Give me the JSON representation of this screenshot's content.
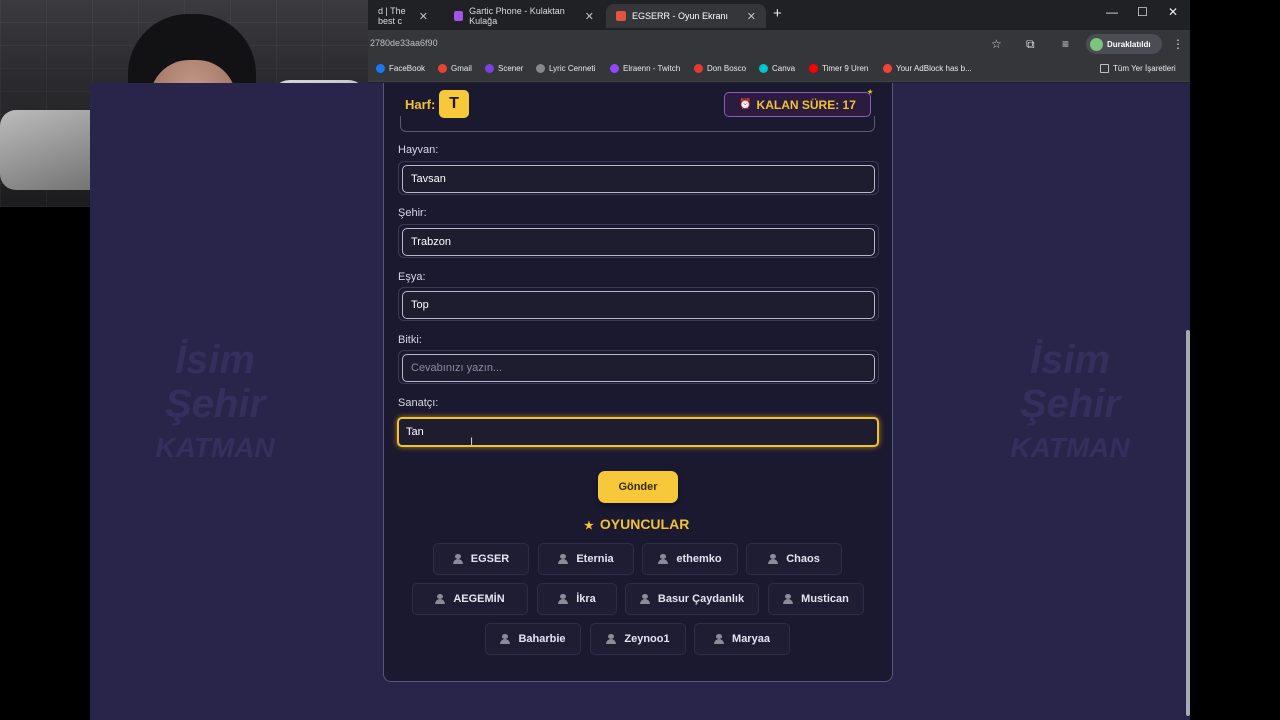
{
  "browser": {
    "tabs": [
      {
        "title": "d | The best c"
      },
      {
        "title": "Gartic Phone - Kulaktan Kulağa"
      },
      {
        "title": "EGSERR - Oyun Ekranı"
      }
    ],
    "url": "2780de33aa6f90",
    "profile_label": "Duraklatıldı",
    "bookmarks": [
      {
        "label": "FaceBook",
        "color": "#1877f2"
      },
      {
        "label": "Gmail",
        "color": "#ea4335"
      },
      {
        "label": "Scener",
        "color": "#7b3fe4"
      },
      {
        "label": "Lyric Cenneti",
        "color": "#888888"
      },
      {
        "label": "Elraenn - Twitch",
        "color": "#9146ff"
      },
      {
        "label": "Don Bosco",
        "color": "#e53935"
      },
      {
        "label": "Canva",
        "color": "#00c4cc"
      },
      {
        "label": "Timer 9 Uren",
        "color": "#ff0000"
      },
      {
        "label": "Your AdBlock has b...",
        "color": "#f44336"
      }
    ],
    "all_bookmarks": "Tüm Yer İşaretleri"
  },
  "game": {
    "letter_label": "Harf:",
    "letter": "T",
    "timer_label": "KALAN SÜRE: 17",
    "fields": [
      {
        "label": "Hayvan:",
        "value": "Tavsan",
        "placeholder": ""
      },
      {
        "label": "Şehir:",
        "value": "Trabzon",
        "placeholder": ""
      },
      {
        "label": "Eşya:",
        "value": "Top",
        "placeholder": ""
      },
      {
        "label": "Bitki:",
        "value": "",
        "placeholder": "Cevabınızı yazın..."
      },
      {
        "label": "Sanatçı:",
        "value": "Tan",
        "placeholder": ""
      }
    ],
    "submit_label": "Gönder",
    "players_title": "OYUNCULAR",
    "players": [
      "EGSER",
      "Eternia",
      "ethemko",
      "Chaos",
      "AEGEMİN",
      "İkra",
      "Basur Çaydanlık",
      "Mustican",
      "Baharbie",
      "Zeynoo1",
      "Maryaa"
    ],
    "background_logo": [
      "İsim",
      "Şehir",
      "KATMAN"
    ]
  },
  "colors": {
    "accent": "#f2c232",
    "page_bg": "#29244a",
    "panel_bg": "#1b1930"
  }
}
